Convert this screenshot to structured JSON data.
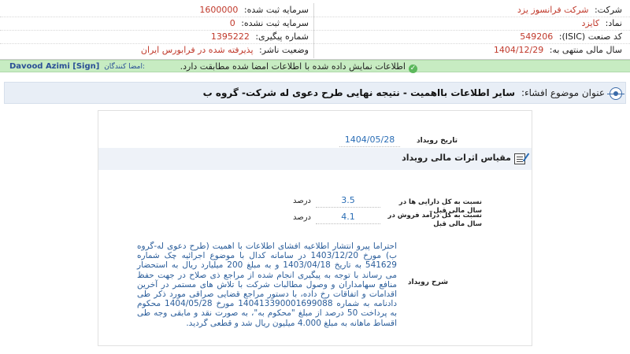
{
  "header": {
    "company": {
      "label": "شرکت:",
      "value": "شرکت فرانسوز یزد"
    },
    "registered_capital": {
      "label": "سرمایه ثبت شده:",
      "value": "1600000"
    },
    "symbol": {
      "label": "نماد:",
      "value": "کایزد"
    },
    "unregistered_capital": {
      "label": "سرمایه ثبت نشده:",
      "value": "0"
    },
    "industry_code": {
      "label": "کد صنعت (ISIC):",
      "value": "549206"
    },
    "tracking_number": {
      "label": "شماره پیگیری:",
      "value": "1395222"
    },
    "fiscal_year_end": {
      "label": "سال مالی منتهی به:",
      "value": "1404/12/29"
    },
    "publisher_status": {
      "label": "وضعیت ناشر:",
      "value": "پذیرفته شده در فرابورس ایران"
    }
  },
  "status_bar": {
    "message": "اطلاعات نمایش داده شده با اطلاعات امضا شده مطابقت دارد.",
    "signed_by_label": "امضا کنندگان:",
    "signer": "Davood Azimi [Sign]",
    "accent_color": "#5cb85c"
  },
  "subject": {
    "label": "عنوان موضوع افشاء:",
    "value": "سایر اطلاعات بااهمیت - نتیجه نهایی طرح دعوی له شرکت- گروه ب"
  },
  "event": {
    "date_label": "تاریخ رویداد",
    "date_value": "1404/05/28"
  },
  "financial_effects": {
    "title": "مقیاس اثرات مالی رویداد",
    "rows": [
      {
        "label": "نسبت به کل دارایی ها در سال مالی قبل",
        "value": "3.5",
        "unit": "درصد"
      },
      {
        "label": "نسبت به کل درآمد فروش در سال مالی قبل",
        "value": "4.1",
        "unit": "درصد"
      }
    ]
  },
  "description": {
    "label": "شرح رویداد",
    "text": "احتراما پیرو انتشار اطلاعیه افشای اطلاعات با اهمیت (طرح دعوی له-گروه ب) مورخ 1403/12/20 در سامانه کدال با موضوع اجرائیه چک شماره 541629 به تاریخ 1403/04/18 و به مبلغ 200 میلیارد ریال به استحضار می رساند با توجه به پیگیری انجام شده از مراجع ذی صلاح در جهت حفظ منافع سهامداران و وصول مطالبات شرکت با تلاش های مستمر در آخرین اقدامات و اتفاقات رخ داده، با دستور مراجع قضایی صراقی مورد ذکر طی دادنامه به شماره 140413390001699088 مورخ 1404/05/28 محکوم به پرداخت 50 درصد از مبلغ \"محکوم به\"، به صورت نقد و مابقی وجه طی اقساط ماهانه به مبلغ 4.000 میلیون ریال شد و قطعی گردید."
  }
}
